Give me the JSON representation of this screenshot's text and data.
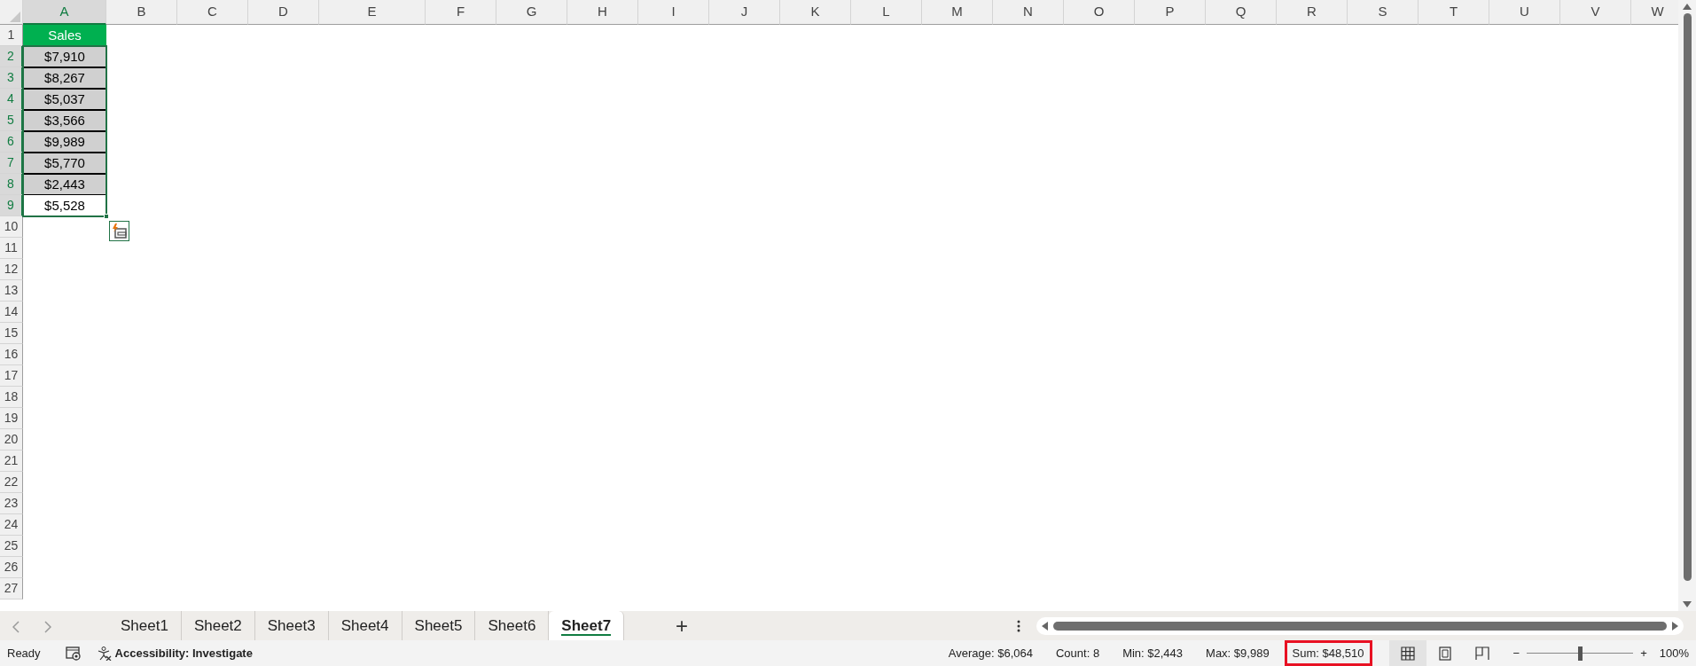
{
  "columns": [
    {
      "label": "A",
      "selected": true
    },
    {
      "label": "B",
      "selected": false
    },
    {
      "label": "C",
      "selected": false
    },
    {
      "label": "D",
      "selected": false
    },
    {
      "label": "E",
      "selected": false
    },
    {
      "label": "F",
      "selected": false
    },
    {
      "label": "G",
      "selected": false
    },
    {
      "label": "H",
      "selected": false
    },
    {
      "label": "I",
      "selected": false
    },
    {
      "label": "J",
      "selected": false
    },
    {
      "label": "K",
      "selected": false
    },
    {
      "label": "L",
      "selected": false
    },
    {
      "label": "M",
      "selected": false
    },
    {
      "label": "N",
      "selected": false
    },
    {
      "label": "O",
      "selected": false
    },
    {
      "label": "P",
      "selected": false
    },
    {
      "label": "Q",
      "selected": false
    },
    {
      "label": "R",
      "selected": false
    },
    {
      "label": "S",
      "selected": false
    },
    {
      "label": "T",
      "selected": false
    },
    {
      "label": "U",
      "selected": false
    },
    {
      "label": "V",
      "selected": false
    },
    {
      "label": "W",
      "selected": false
    }
  ],
  "rows": [
    {
      "label": "1",
      "selected": false
    },
    {
      "label": "2",
      "selected": true
    },
    {
      "label": "3",
      "selected": true
    },
    {
      "label": "4",
      "selected": true
    },
    {
      "label": "5",
      "selected": true
    },
    {
      "label": "6",
      "selected": true
    },
    {
      "label": "7",
      "selected": true
    },
    {
      "label": "8",
      "selected": true
    },
    {
      "label": "9",
      "selected": true
    },
    {
      "label": "10",
      "selected": false
    },
    {
      "label": "11",
      "selected": false
    },
    {
      "label": "12",
      "selected": false
    },
    {
      "label": "13",
      "selected": false
    },
    {
      "label": "14",
      "selected": false
    },
    {
      "label": "15",
      "selected": false
    },
    {
      "label": "16",
      "selected": false
    },
    {
      "label": "17",
      "selected": false
    },
    {
      "label": "18",
      "selected": false
    },
    {
      "label": "19",
      "selected": false
    },
    {
      "label": "20",
      "selected": false
    },
    {
      "label": "21",
      "selected": false
    },
    {
      "label": "22",
      "selected": false
    },
    {
      "label": "23",
      "selected": false
    },
    {
      "label": "24",
      "selected": false
    },
    {
      "label": "25",
      "selected": false
    },
    {
      "label": "26",
      "selected": false
    },
    {
      "label": "27",
      "selected": false
    }
  ],
  "column_a": [
    {
      "value": "Sales",
      "kind": "header"
    },
    {
      "value": "$7,910",
      "kind": "shaded"
    },
    {
      "value": "$8,267",
      "kind": "shaded"
    },
    {
      "value": "$5,037",
      "kind": "shaded"
    },
    {
      "value": "$3,566",
      "kind": "shaded"
    },
    {
      "value": "$9,989",
      "kind": "shaded"
    },
    {
      "value": "$5,770",
      "kind": "shaded"
    },
    {
      "value": "$2,443",
      "kind": "shaded"
    },
    {
      "value": "$5,528",
      "kind": "plain"
    }
  ],
  "sheet_tabs": [
    {
      "label": "Sheet1",
      "selected": false
    },
    {
      "label": "Sheet2",
      "selected": false
    },
    {
      "label": "Sheet3",
      "selected": false
    },
    {
      "label": "Sheet4",
      "selected": false
    },
    {
      "label": "Sheet5",
      "selected": false
    },
    {
      "label": "Sheet6",
      "selected": false
    },
    {
      "label": "Sheet7",
      "selected": true
    }
  ],
  "add_sheet": "+",
  "status_bar": {
    "mode": "Ready",
    "accessibility": "Accessibility: Investigate",
    "stats": [
      {
        "text": "Average: $6,064",
        "highlighted": false
      },
      {
        "text": "Count: 8",
        "highlighted": false
      },
      {
        "text": "Min: $2,443",
        "highlighted": false
      },
      {
        "text": "Max: $9,989",
        "highlighted": false
      },
      {
        "text": "Sum: $48,510",
        "highlighted": true
      }
    ],
    "views": [
      {
        "kind": "normal",
        "selected": true
      },
      {
        "kind": "page_layout",
        "selected": false
      },
      {
        "kind": "page_break",
        "selected": false
      }
    ],
    "zoom": {
      "minus": "−",
      "plus": "+",
      "level": 0.5,
      "reading": "100%"
    }
  }
}
